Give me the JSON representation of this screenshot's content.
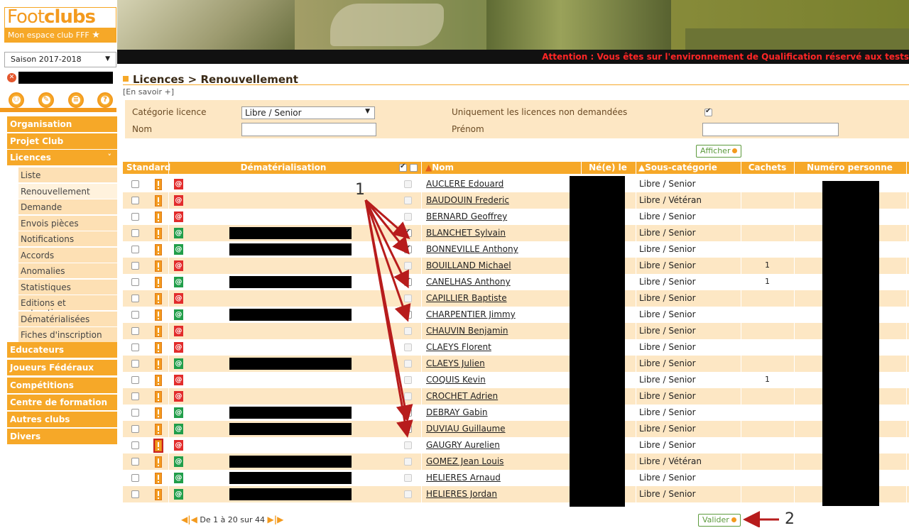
{
  "logo": {
    "title_light": "Foot",
    "title_bold": "clubs",
    "subtitle": "Mon espace club FFF"
  },
  "season": {
    "value": "Saison 2017-2018"
  },
  "warning": "Attention : Vous êtes sur l'environnement de Qualification réservé aux tests",
  "nav": {
    "organisation": "Organisation",
    "projet_club": "Projet Club",
    "licences": "Licences",
    "licences_items": [
      "Liste",
      "Renouvellement",
      "Demande",
      "Envois pièces",
      "Notifications",
      "Accords",
      "Anomalies",
      "Statistiques",
      "Editions et extractions",
      "Dématérialisées",
      "Fiches d'inscription"
    ],
    "educateurs": "Educateurs",
    "joueurs_federaux": "Joueurs Fédéraux",
    "competitions": "Compétitions",
    "centre_formation": "Centre de formation",
    "autres_clubs": "Autres clubs",
    "divers": "Divers"
  },
  "page": {
    "title": "Licences > Renouvellement",
    "more_info": "[En savoir +]"
  },
  "filters": {
    "categorie_label": "Catégorie licence",
    "categorie_value": "Libre / Senior",
    "uniquement_label": "Uniquement les licences non demandées",
    "nom_label": "Nom",
    "prenom_label": "Prénom",
    "afficher": "Afficher"
  },
  "table": {
    "headers": {
      "standard": "Standard",
      "demat": "Dématérialisation",
      "nom": "Nom",
      "ne_le": "Né(e) le",
      "sous_cat": "Sous-catégorie",
      "cachets": "Cachets",
      "numero": "Numéro personne"
    },
    "rows": [
      {
        "name": "AUCLERE Edouard",
        "cat": "Libre / Senior",
        "cachets": "",
        "at": "red",
        "checked": false,
        "demat": false
      },
      {
        "name": "BAUDOUIN Frederic",
        "cat": "Libre / Vétéran",
        "cachets": "",
        "at": "red",
        "checked": false,
        "demat": false
      },
      {
        "name": "BERNARD Geoffrey",
        "cat": "Libre / Senior",
        "cachets": "",
        "at": "red",
        "checked": false,
        "demat": false
      },
      {
        "name": "BLANCHET Sylvain",
        "cat": "Libre / Senior",
        "cachets": "",
        "at": "green",
        "checked": true,
        "demat": true
      },
      {
        "name": "BONNEVILLE Anthony",
        "cat": "Libre / Senior",
        "cachets": "",
        "at": "green",
        "checked": true,
        "demat": true
      },
      {
        "name": "BOUILLAND Michael",
        "cat": "Libre / Senior",
        "cachets": "1",
        "at": "red",
        "checked": false,
        "demat": false
      },
      {
        "name": "CANELHAS Anthony",
        "cat": "Libre / Senior",
        "cachets": "1",
        "at": "green",
        "checked": true,
        "demat": true
      },
      {
        "name": "CAPILLIER Baptiste",
        "cat": "Libre / Senior",
        "cachets": "",
        "at": "red",
        "checked": false,
        "demat": false
      },
      {
        "name": "CHARPENTIER Jimmy",
        "cat": "Libre / Senior",
        "cachets": "",
        "at": "green",
        "checked": true,
        "demat": true
      },
      {
        "name": "CHAUVIN Benjamin",
        "cat": "Libre / Senior",
        "cachets": "",
        "at": "red",
        "checked": false,
        "demat": false
      },
      {
        "name": "CLAEYS Florent",
        "cat": "Libre / Senior",
        "cachets": "",
        "at": "red",
        "checked": false,
        "demat": false
      },
      {
        "name": "CLAEYS Julien",
        "cat": "Libre / Senior",
        "cachets": "",
        "at": "green",
        "checked": false,
        "demat": true
      },
      {
        "name": "COQUIS Kevin",
        "cat": "Libre / Senior",
        "cachets": "1",
        "at": "red",
        "checked": false,
        "demat": false
      },
      {
        "name": "CROCHET Adrien",
        "cat": "Libre / Senior",
        "cachets": "",
        "at": "red",
        "checked": false,
        "demat": false
      },
      {
        "name": "DEBRAY Gabin",
        "cat": "Libre / Senior",
        "cachets": "",
        "at": "green",
        "checked": true,
        "demat": true
      },
      {
        "name": "DUVIAU Guillaume",
        "cat": "Libre / Senior",
        "cachets": "",
        "at": "green",
        "checked": true,
        "demat": true
      },
      {
        "name": "GAUGRY Aurelien",
        "cat": "Libre / Senior",
        "cachets": "",
        "at": "red",
        "checked": false,
        "demat": false
      },
      {
        "name": "GOMEZ Jean Louis",
        "cat": "Libre / Vétéran",
        "cachets": "",
        "at": "green",
        "checked": false,
        "demat": true
      },
      {
        "name": "HELIERES Arnaud",
        "cat": "Libre / Senior",
        "cachets": "",
        "at": "green",
        "checked": false,
        "demat": true
      },
      {
        "name": "HELIERES Jordan",
        "cat": "Libre / Senior",
        "cachets": "",
        "at": "green",
        "checked": false,
        "demat": true
      }
    ]
  },
  "pager": {
    "text": "De 1 à 20 sur 44"
  },
  "valider": "Valider",
  "annotations": {
    "one": "1",
    "two": "2"
  },
  "colors": {
    "accent": "#f6a828",
    "arrow": "#b71c1c",
    "green": "#219e4a",
    "red": "#e22c2c"
  }
}
